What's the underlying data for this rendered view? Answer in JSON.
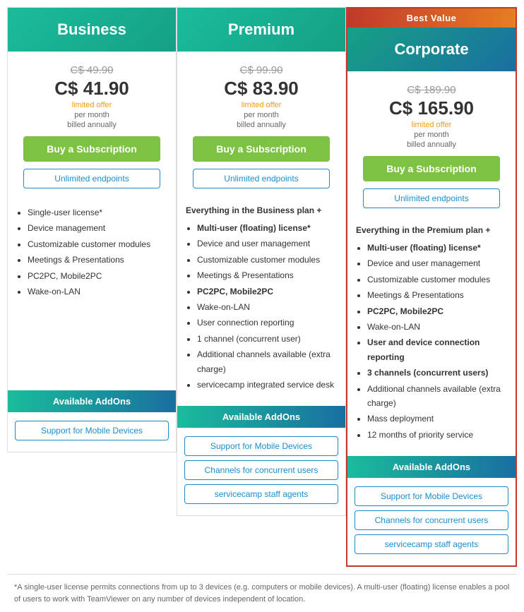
{
  "plans": [
    {
      "id": "business",
      "name": "Business",
      "bestValue": false,
      "originalPrice": "C$ 49.90",
      "currentPrice": "C$ 41.90",
      "limitedOffer": "limited offer",
      "billingInfo1": "per month",
      "billingInfo2": "billed annually",
      "buyLabel": "Buy a Subscription",
      "endpointsLabel": "Unlimited endpoints",
      "includes": "",
      "features": [
        "Single-user license*",
        "Device management",
        "Customizable customer modules",
        "Meetings & Presentations",
        "PC2PC, Mobile2PC",
        "Wake-on-LAN"
      ],
      "addonsLabel": "Available AddOns",
      "addons": [
        "Support for Mobile Devices"
      ]
    },
    {
      "id": "premium",
      "name": "Premium",
      "bestValue": false,
      "originalPrice": "C$ 99.90",
      "currentPrice": "C$ 83.90",
      "limitedOffer": "limited offer",
      "billingInfo1": "per month",
      "billingInfo2": "billed annually",
      "buyLabel": "Buy a Subscription",
      "endpointsLabel": "Unlimited endpoints",
      "includes": "Everything in the Business plan +",
      "features": [
        "Multi-user (floating) license*",
        "Device and user management",
        "Customizable customer modules",
        "Meetings & Presentations",
        "PC2PC, Mobile2PC",
        "Wake-on-LAN",
        "User connection reporting",
        "1 channel (concurrent user)",
        "Additional channels available (extra charge)",
        "servicecamp integrated service desk"
      ],
      "boldFeatures": [
        "Multi-user (floating) license*",
        "PC2PC, Mobile2PC"
      ],
      "addonsLabel": "Available AddOns",
      "addons": [
        "Support for Mobile Devices",
        "Channels for concurrent users",
        "servicecamp staff agents"
      ]
    },
    {
      "id": "corporate",
      "name": "Corporate",
      "bestValue": true,
      "bestValueLabel": "Best Value",
      "originalPrice": "C$ 189.90",
      "currentPrice": "C$ 165.90",
      "limitedOffer": "limited offer",
      "billingInfo1": "per month",
      "billingInfo2": "billed annually",
      "buyLabel": "Buy a Subscription",
      "endpointsLabel": "Unlimited endpoints",
      "includes": "Everything in the Premium plan +",
      "features": [
        "Multi-user (floating) license*",
        "Device and user management",
        "Customizable customer modules",
        "Meetings & Presentations",
        "PC2PC, Mobile2PC",
        "Wake-on-LAN",
        "User and device connection reporting",
        "3 channels (concurrent users)",
        "Additional channels available (extra charge)",
        "Mass deployment",
        "12 months of priority service"
      ],
      "boldFeatures": [
        "Multi-user (floating) license*",
        "PC2PC, Mobile2PC",
        "User and device connection reporting",
        "3 channels (concurrent users)"
      ],
      "addonsLabel": "Available AddOns",
      "addons": [
        "Support for Mobile Devices",
        "Channels for concurrent users",
        "servicecamp staff agents"
      ]
    }
  ],
  "footnote": "*A single-user license permits connections from up to 3 devices (e.g. computers or mobile devices). A multi-user (floating) license enables a pool of users to work with TeamViewer on any number of devices independent of location."
}
